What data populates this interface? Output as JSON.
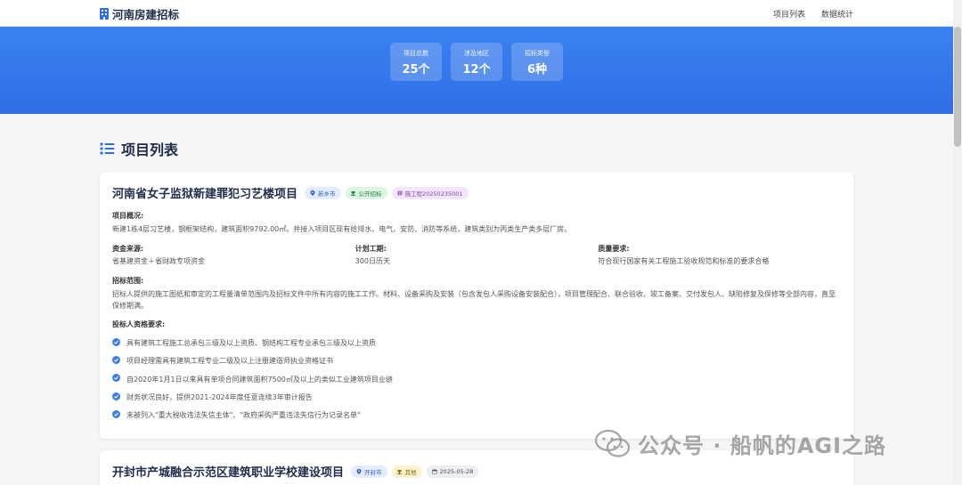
{
  "nav": {
    "brand": "河南房建招标",
    "links": [
      "项目列表",
      "数据统计"
    ]
  },
  "stats": [
    {
      "label": "项目总数",
      "value": "25个"
    },
    {
      "label": "涉及地区",
      "value": "12个"
    },
    {
      "label": "招标类型",
      "value": "6种"
    }
  ],
  "section": {
    "title": "项目列表"
  },
  "projects": [
    {
      "title": "河南省女子监狱新建罪犯习艺楼项目",
      "tags": [
        "新乡市",
        "公开招标",
        "施工程20250235001"
      ],
      "overview_label": "项目概况:",
      "overview": "新建1栋4层习艺楼，钢框架结构，建筑面积9792.00㎡。并接入项目区现有给排水、电气、安防、消防等系统，建筑类别为丙类生产类多层厂房。",
      "funding_label": "资金来源:",
      "funding": "省基建资金＋省财政专项资金",
      "period_label": "计划工期:",
      "period": "300日历天",
      "quality_label": "质量要求:",
      "quality": "符合现行国家有关工程施工验收规范和标准的要求合格",
      "scope_label": "招标范围:",
      "scope": "招标人提供的施工图纸和审定的工程量清单范围内及招标文件中所有内容的施工工作。材料、设备采购及安装（包含发包人采购设备安装配合），项目管理配合、联合验收、竣工备案、交付发包人、缺陷修复及保修等全部内容，直至保修期满。",
      "req_label": "投标人资格要求:",
      "requirements": [
        "具有建筑工程施工总承包三级及以上资质、钢结构工程专业承包三级及以上资质",
        "项目经理需具有建筑工程专业二级及以上注册建造师执业资格证书",
        "自2020年1月1日以来具有单项合同建筑面积7500㎡及以上的类似工业建筑项目业绩",
        "财务状况良好，提供2021-2024年度任意连续3年审计报告",
        "未被列入\"重大税收违法失信主体\"、\"政府采购严重违法失信行为记录名单\""
      ]
    },
    {
      "title": "开封市产城融合示范区建筑职业学校建设项目",
      "tags": [
        "开封市",
        "其他",
        "2025-05-28"
      ]
    }
  ],
  "watermark": "公众号 · 船帆的AGI之路",
  "colors": {
    "primary": "#2f6ee6",
    "check": "#3b7de9",
    "title": "#1f2d4a"
  }
}
